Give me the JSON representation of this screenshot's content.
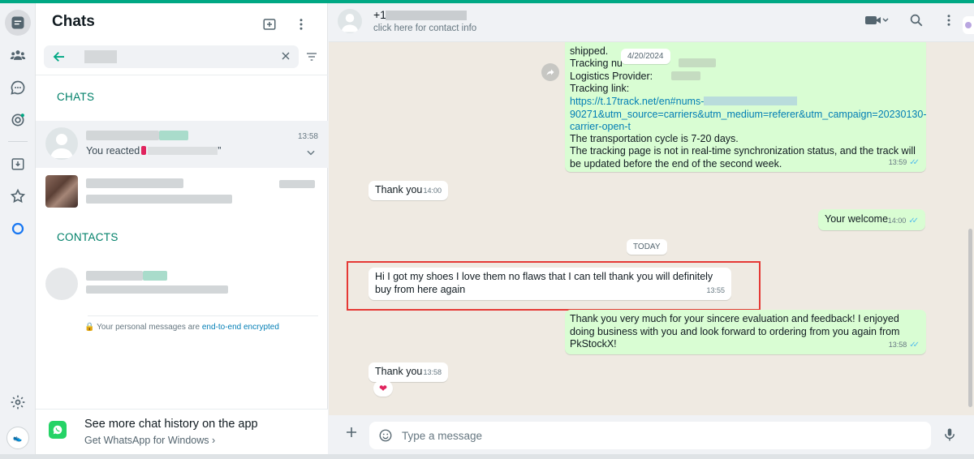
{
  "list": {
    "title": "Chats",
    "chats_label": "CHATS",
    "contacts_label": "CONTACTS",
    "chat1": {
      "time": "13:58",
      "preview": "You reacted",
      "preview_end": "”"
    },
    "encryption_text": "Your personal messages are",
    "encryption_link": "end-to-end encrypted",
    "promo_title": "See more chat history on the app",
    "promo_sub": "Get WhatsApp for Windows"
  },
  "rail": {
    "avatar_text": "👟"
  },
  "conversation": {
    "name_prefix": "+1",
    "subtitle": "click here for contact info",
    "date_chip_top": "4/20/2024",
    "date_chip_today": "TODAY",
    "messages": [
      {
        "direction": "out",
        "lines": [
          "shipped.",
          "Tracking nu",
          "Logistics Provider:",
          "Tracking link:"
        ],
        "link": "https://t.17track.net/en#nums-",
        "link_tail": "90271&utm_source=carriers&utm_medium=referer&utm_campaign=20230130-carrier-open-t",
        "cycle": "The transportation cycle is 7-20 days.",
        "note": "The tracking page is not in real-time synchronization status, and the track will be updated before the end of the second week.",
        "time": "13:59"
      },
      {
        "direction": "in",
        "text": "Thank you",
        "time": "14:00"
      },
      {
        "direction": "out",
        "text": "Your welcome",
        "time": "14:00"
      },
      {
        "direction": "in",
        "text": "Hi I got my shoes I love them no flaws that I can tell thank you will definitely buy from here again",
        "time": "13:55"
      },
      {
        "direction": "out",
        "text": "Thank you very much for your sincere evaluation and feedback! I enjoyed doing business with you and look forward to ordering from you again from PkStockX!",
        "time": "13:58"
      },
      {
        "direction": "in",
        "text": "Thank you",
        "time": "13:58",
        "reaction": "❤"
      }
    ],
    "composer_placeholder": "Type a message"
  },
  "colors": {
    "accent": "#00a884",
    "outgoing": "#d9fdd3",
    "incoming": "#ffffff",
    "background": "#efeae2",
    "highlight_box": "#e53935",
    "read_tick": "#53bdeb"
  }
}
